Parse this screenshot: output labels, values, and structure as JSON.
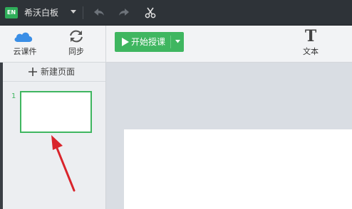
{
  "app": {
    "logo_text": "EN",
    "title": "希沃白板"
  },
  "toolbar": {
    "cloud_label": "云课件",
    "sync_label": "同步",
    "start_label": "开始授课",
    "text_tool_glyph": "T",
    "text_tool_label": "文本"
  },
  "sidebar": {
    "new_page_label": "新建页面",
    "pages": [
      {
        "number": "1"
      }
    ]
  },
  "colors": {
    "accent": "#3fb660",
    "titlebar": "#2e3338",
    "annotation_arrow": "#d9242b"
  },
  "icons": [
    "cloud-icon",
    "sync-icon",
    "undo-icon",
    "redo-icon",
    "scissors-icon",
    "play-icon",
    "chevron-down-icon",
    "plus-icon"
  ]
}
